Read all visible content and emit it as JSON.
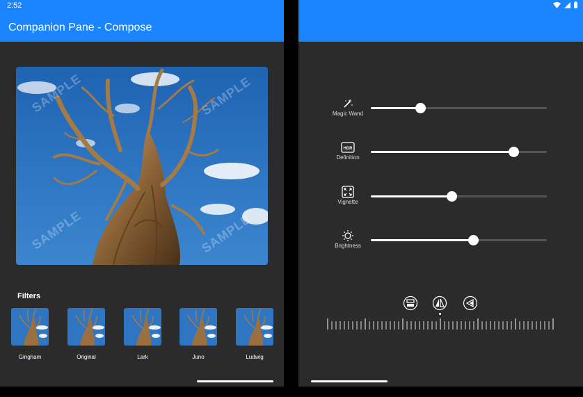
{
  "status": {
    "time": "2:52"
  },
  "app": {
    "title": "Companion Pane - Compose"
  },
  "photo": {
    "watermark": "SAMPLE"
  },
  "filters": {
    "title": "Filters",
    "items": [
      "Gingham",
      "Original",
      "Lark",
      "Juno",
      "Ludwig"
    ]
  },
  "adjustments": [
    {
      "label": "Magic Wand",
      "icon": "magic-wand-icon",
      "value": 0.28
    },
    {
      "label": "Definition",
      "icon": "hdr-icon",
      "value": 0.81
    },
    {
      "label": "Vignette",
      "icon": "vignette-icon",
      "value": 0.46
    },
    {
      "label": "Brightness",
      "icon": "brightness-icon",
      "value": 0.58
    }
  ],
  "modes": {
    "icons": [
      "flip-vertical-icon",
      "flip-horizontal-icon",
      "rotate-icon"
    ],
    "selected": 1
  },
  "colors": {
    "appbar": "#1a85ff",
    "background": "#2b2b2b"
  }
}
